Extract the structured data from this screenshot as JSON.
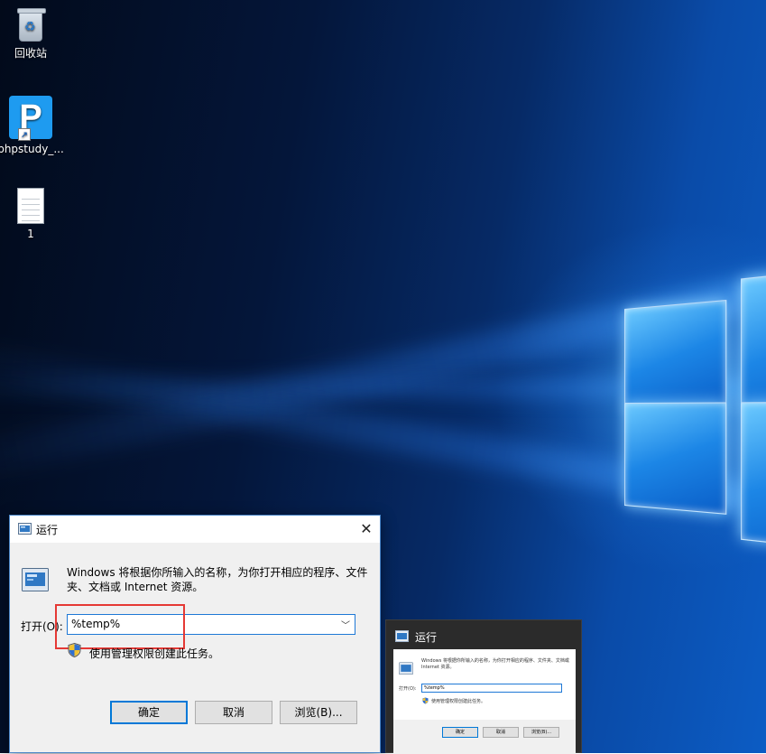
{
  "desktop": {
    "icons": [
      {
        "name": "recycle-bin",
        "label": "回收站"
      },
      {
        "name": "phpstudy",
        "label": "phpstudy_...",
        "tile_letter": "P"
      },
      {
        "name": "text-file",
        "label": "1"
      }
    ]
  },
  "run_dialog": {
    "title": "运行",
    "close_glyph": "✕",
    "description": "Windows 将根据你所输入的名称，为你打开相应的程序、文件夹、文档或 Internet 资源。",
    "open_label": "打开(O):",
    "input_value": "%temp%",
    "admin_note": "使用管理权限创建此任务。",
    "buttons": {
      "ok": "确定",
      "cancel": "取消",
      "browse": "浏览(B)..."
    }
  },
  "thumbnail": {
    "title": "运行",
    "description": "Windows 将根据你所输入的名称，为你打开相应的程序、文件夹、文档或 Internet 资源。",
    "open_label": "打开(O):",
    "input_value": "%temp%",
    "admin_note": "使用管理权限创建此任务。",
    "buttons": {
      "ok": "确定",
      "cancel": "取消",
      "browse": "浏览(B)..."
    }
  },
  "colors": {
    "accent": "#0078d7",
    "highlight": "#e53935",
    "dialog_bg": "#f0f0f0"
  }
}
